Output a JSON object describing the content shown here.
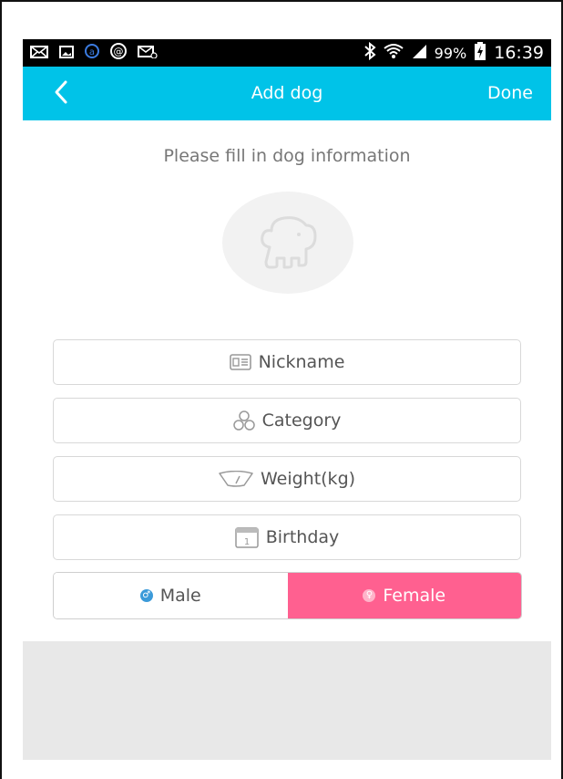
{
  "status_bar": {
    "battery": "99%",
    "time": "16:39",
    "icons": [
      "mail-icon",
      "image-icon",
      "sync-icon",
      "at-icon",
      "mail-alt-icon",
      "bluetooth-icon",
      "wifi-icon",
      "signal-icon",
      "battery-charging-icon"
    ]
  },
  "app_bar": {
    "title": "Add dog",
    "done_label": "Done",
    "color": "#00c3e8"
  },
  "form": {
    "prompt": "Please fill in dog information",
    "fields": [
      {
        "label": "Nickname",
        "icon": "id-card-icon"
      },
      {
        "label": "Category",
        "icon": "category-icon"
      },
      {
        "label": "Weight(kg)",
        "icon": "scale-icon"
      },
      {
        "label": "Birthday",
        "icon": "calendar-icon"
      }
    ],
    "gender": {
      "male_label": "Male",
      "female_label": "Female",
      "selected": "Female",
      "female_color": "#ff6090",
      "male_icon_color": "#3b9ad9"
    },
    "calendar_day": "1"
  }
}
